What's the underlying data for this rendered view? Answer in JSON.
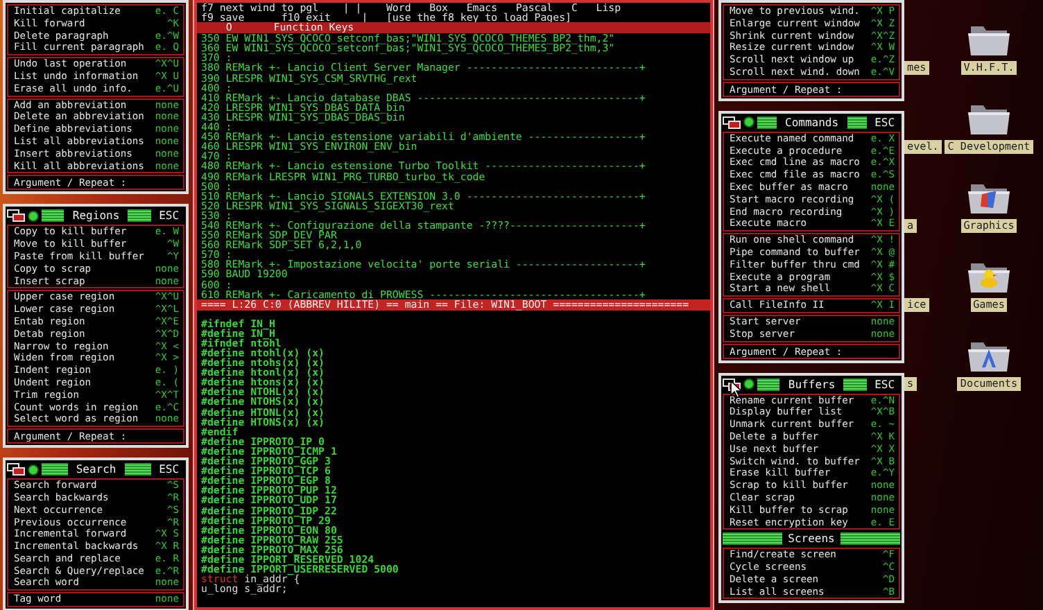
{
  "left_panels": [
    {
      "sections": [
        {
          "items": [
            {
              "label": "Initial capitalize",
              "key": "e. C"
            },
            {
              "label": "Kill forward",
              "key": "^K"
            },
            {
              "label": "Delete paragraph",
              "key": "e.^W"
            },
            {
              "label": "Fill current paragraph",
              "key": "e. Q"
            }
          ]
        },
        {
          "items": [
            {
              "label": "Undo last operation",
              "key": "^X^U"
            },
            {
              "label": "List undo information",
              "key": "^X U"
            },
            {
              "label": "Erase all undo info.",
              "key": "e.^U"
            }
          ]
        },
        {
          "items": [
            {
              "label": "Add an abbreviation",
              "key": "none"
            },
            {
              "label": "Delete an abbreviation",
              "key": "none"
            },
            {
              "label": "Define abbreviations",
              "key": "none"
            },
            {
              "label": "List all abbreviations",
              "key": "none"
            },
            {
              "label": "Insert abbreviations",
              "key": "none"
            },
            {
              "label": "Kill all abbreviations",
              "key": "none"
            }
          ]
        }
      ],
      "argument": "Argument / Repeat :"
    },
    {
      "title": "Regions",
      "esc": "ESC",
      "sections": [
        {
          "items": [
            {
              "label": "Copy to kill buffer",
              "key": "e. W"
            },
            {
              "label": "Move to kill buffer",
              "key": "^W"
            },
            {
              "label": "Paste from kill buffer",
              "key": "^Y"
            },
            {
              "label": "Copy to scrap",
              "key": "none"
            },
            {
              "label": "Insert scrap",
              "key": "none"
            }
          ]
        },
        {
          "items": [
            {
              "label": "Upper case region",
              "key": "^X^U"
            },
            {
              "label": "Lower case region",
              "key": "^X^L"
            },
            {
              "label": "Entab region",
              "key": "^X^E"
            },
            {
              "label": "Detab region",
              "key": "^X^D"
            },
            {
              "label": "Narrow to region",
              "key": "^X <"
            },
            {
              "label": "Widen from region",
              "key": "^X >"
            },
            {
              "label": "Indent region",
              "key": "e. )"
            },
            {
              "label": "Undent region",
              "key": "e. ("
            },
            {
              "label": "Trim region",
              "key": "^X^T"
            },
            {
              "label": "Count words in region",
              "key": "e.^C"
            },
            {
              "label": "Select word as region",
              "key": "none"
            }
          ]
        }
      ],
      "argument": "Argument / Repeat :"
    },
    {
      "title": "Search",
      "esc": "ESC",
      "sections": [
        {
          "items": [
            {
              "label": "Search forward",
              "key": "^S"
            },
            {
              "label": "Search backwards",
              "key": "^R"
            },
            {
              "label": "Next occurrence",
              "key": "^S"
            },
            {
              "label": "Previous occurrence",
              "key": "^R"
            },
            {
              "label": "Incremental forward",
              "key": "^X S"
            },
            {
              "label": "Incremental backwards",
              "key": "^X R"
            },
            {
              "label": "Search and replace",
              "key": "e. R"
            },
            {
              "label": "Search & Query/replace",
              "key": "e.^R"
            },
            {
              "label": "Search word",
              "key": "none"
            }
          ]
        },
        {
          "items": [
            {
              "label": "Tag word",
              "key": "none"
            }
          ]
        }
      ]
    }
  ],
  "editor": {
    "fkey_lines": [
      "f7 next wind to pgl    | |    Word   Box   Emacs   Pascal   C   Lisp",
      "f9 save      f10 exit     |   [use the f8 key to load Pages]"
    ],
    "bar": {
      "mark": "O",
      "label": "Function Keys"
    },
    "top_lines": [
      "350 EW WIN1_SYS_QCOCO_setconf_bas;\"WIN1_SYS_QCOCO_THEMES_BP2_thm,2\"",
      "360 EW WIN1_SYS_QCOCO_setconf_bas;\"WIN1_SYS_QCOCO_THEMES_BP2_thm,3\"",
      "370 :",
      "380 REMark +- Lancio Client Server Manager ----------------------------+",
      "390 LRESPR WIN1_SYS_CSM_SRVTHG_rext",
      "400 :",
      "410 REMark +- Lancio database DBAS ------------------------------------+",
      "420 LRESPR WIN1_SYS_DBAS_DATA_bin",
      "430 LRESPR WIN1_SYS_DBAS_DBAS_bin",
      "440 :",
      "450 REMark +- Lancio estensione variabili d'ambiente ------------------+",
      "460 LRESPR WIN1_SYS_ENVIRON_ENV_bin",
      "470 :",
      "480 REMark +- Lancio estensione Turbo Toolkit -------------------------+",
      "490 REMark LRESPR WIN1_PRG_TURBO_turbo_tk_code",
      "500 :",
      "510 REMark +- Lancio SIGNALS EXTENSION 3.0 ----------------------------+",
      "520 LRESPR WIN1_SYS_SIGNALS_SIGEXT30_rext",
      "530 :",
      "540 REMark +- Configurazione della stampante -????---------------------+",
      "550 REMark SDP_DEV PAR",
      "560 REMark SDP_SET 6,2,1,0",
      "570 :",
      "580 REMark +- Impostazione velocita' porte seriali --------------------+",
      "590 BAUD 19200",
      "600 :",
      "610 REMark +- Caricamento di PROWESS ----------------------------------+"
    ],
    "status": "==== L:26 C:0 (ABBREV HILITE) == main == File: WIN1_BOOT ======================",
    "bottom_lines": [
      [
        {
          "kind": "directive",
          "text": "#ifndef IN_H"
        }
      ],
      [
        {
          "kind": "directive",
          "text": "#define IN_H"
        }
      ],
      [
        {
          "kind": "directive",
          "text": "#ifndef ntohl"
        }
      ],
      [
        {
          "kind": "directive",
          "text": "#define ntohl(x) (x)"
        }
      ],
      [
        {
          "kind": "directive",
          "text": "#define ntohs(x) (x)"
        }
      ],
      [
        {
          "kind": "directive",
          "text": "#define htonl(x) (x)"
        }
      ],
      [
        {
          "kind": "directive",
          "text": "#define htons(x) (x)"
        }
      ],
      [
        {
          "kind": "directive",
          "text": "#define NTOHL(x) (x)"
        }
      ],
      [
        {
          "kind": "directive",
          "text": "#define NTOHS(x) (x)"
        }
      ],
      [
        {
          "kind": "directive",
          "text": "#define HTONL(x) (x)"
        }
      ],
      [
        {
          "kind": "directive",
          "text": "#define HTONS(x) (x)"
        }
      ],
      [
        {
          "kind": "directive",
          "text": "#endif"
        }
      ],
      [
        {
          "kind": "directive",
          "text": "#define IPPROTO_IP 0"
        }
      ],
      [
        {
          "kind": "directive",
          "text": "#define IPPROTO_ICMP 1"
        }
      ],
      [
        {
          "kind": "directive",
          "text": "#define IPPROTO_GGP 3"
        }
      ],
      [
        {
          "kind": "directive",
          "text": "#define IPPROTO_TCP 6"
        }
      ],
      [
        {
          "kind": "directive",
          "text": "#define IPPROTO_EGP 8"
        }
      ],
      [
        {
          "kind": "directive",
          "text": "#define IPPROTO_PUP 12"
        }
      ],
      [
        {
          "kind": "directive",
          "text": "#define IPPROTO_UDP 17"
        }
      ],
      [
        {
          "kind": "directive",
          "text": "#define IPPROTO_IDP 22"
        }
      ],
      [
        {
          "kind": "directive",
          "text": "#define IPPROTO_TP 29"
        }
      ],
      [
        {
          "kind": "directive",
          "text": "#define IPPROTO_EON 80"
        }
      ],
      [
        {
          "kind": "directive",
          "text": "#define IPPROTO_RAW 255"
        }
      ],
      [
        {
          "kind": "directive",
          "text": "#define IPPROTO_MAX 256"
        }
      ],
      [
        {
          "kind": "directive",
          "text": "#define IPPORT_RESERVED 1024"
        }
      ],
      [
        {
          "kind": "directive",
          "text": "#define IPPORT_USERRESERVED 5000"
        }
      ],
      [
        {
          "kind": "keyword",
          "text": "struct"
        },
        {
          "kind": "plain",
          "text": " in_addr {"
        }
      ],
      [
        {
          "kind": "plain",
          "text": "u_long s_addr;"
        }
      ]
    ]
  },
  "right_panels": [
    {
      "sections": [
        {
          "items": [
            {
              "label": "Move to previous wind.",
              "key": "^X P"
            },
            {
              "label": "Enlarge current window",
              "key": "^X Z"
            },
            {
              "label": "Shrink current window",
              "key": "^X^Z"
            },
            {
              "label": "Resize current window",
              "key": "^X W"
            },
            {
              "label": "Scroll next window up",
              "key": "e.^Z"
            },
            {
              "label": "Scroll next wind. down",
              "key": "e.^V"
            }
          ]
        }
      ],
      "argument": "Argument / Repeat :"
    },
    {
      "title": "Commands",
      "esc": "ESC",
      "sections": [
        {
          "items": [
            {
              "label": "Execute named command",
              "key": "e. X"
            },
            {
              "label": "Execute a procedure",
              "key": "e.^E"
            },
            {
              "label": "Exec cmd line as macro",
              "key": "e.^X"
            },
            {
              "label": "Exec cmd file as macro",
              "key": "e.^S"
            },
            {
              "label": "Exec buffer as macro",
              "key": "none"
            },
            {
              "label": "Start macro recording",
              "key": "^X ("
            },
            {
              "label": "End macro recording",
              "key": "^X )"
            },
            {
              "label": "Execute macro",
              "key": "^X E"
            }
          ]
        },
        {
          "items": [
            {
              "label": "Run one shell command",
              "key": "^X !"
            },
            {
              "label": "Pipe command to buffer",
              "key": "^X @"
            },
            {
              "label": "Filter buffer thru cmd",
              "key": "^X #"
            },
            {
              "label": "Execute a program",
              "key": "^X $"
            },
            {
              "label": "Start a new shell",
              "key": "^X C"
            }
          ]
        },
        {
          "items": [
            {
              "label": "Call FileInfo II",
              "key": "^X I"
            }
          ]
        },
        {
          "items": [
            {
              "label": "Start server",
              "key": "none"
            },
            {
              "label": "Stop server",
              "key": "none"
            }
          ]
        }
      ],
      "argument": "Argument / Repeat :"
    },
    {
      "title": "Buffers",
      "esc": "ESC",
      "pointer": true,
      "sections": [
        {
          "items": [
            {
              "label": "Rename current buffer",
              "key": "e.^N"
            },
            {
              "label": "Display buffer list",
              "key": "^X^B"
            },
            {
              "label": "Unmark current buffer",
              "key": "e. ~"
            },
            {
              "label": "Delete a buffer",
              "key": "^X K"
            },
            {
              "label": "Use next buffer",
              "key": "^X X"
            },
            {
              "label": "Switch wind. to buffer",
              "key": "^X B"
            },
            {
              "label": "Erase kill buffer",
              "key": "e.^Y"
            },
            {
              "label": "Scrap to kill buffer",
              "key": "none"
            },
            {
              "label": "Clear scrap",
              "key": "none"
            },
            {
              "label": "Kill buffer to scrap",
              "key": "none"
            },
            {
              "label": "Reset encryption key",
              "key": "e. E"
            }
          ]
        },
        {
          "heading": "Screens",
          "items": [
            {
              "label": "Find/create screen",
              "key": "^F"
            },
            {
              "label": "Cycle screens",
              "key": "^C"
            },
            {
              "label": "Delete a screen",
              "key": "^D"
            },
            {
              "label": "List all screens",
              "key": "^B"
            }
          ]
        }
      ]
    }
  ],
  "desktop": {
    "partial_labels": [
      "mes",
      "evel.",
      "a",
      "ice",
      "s"
    ],
    "icons": [
      {
        "label": "V.H.F.T.",
        "kind": "folder"
      },
      {
        "label": "C Development",
        "kind": "folder"
      },
      {
        "label": "Graphics",
        "kind": "graphics"
      },
      {
        "label": "Games",
        "kind": "games"
      },
      {
        "label": "Documents",
        "kind": "documents"
      }
    ]
  }
}
